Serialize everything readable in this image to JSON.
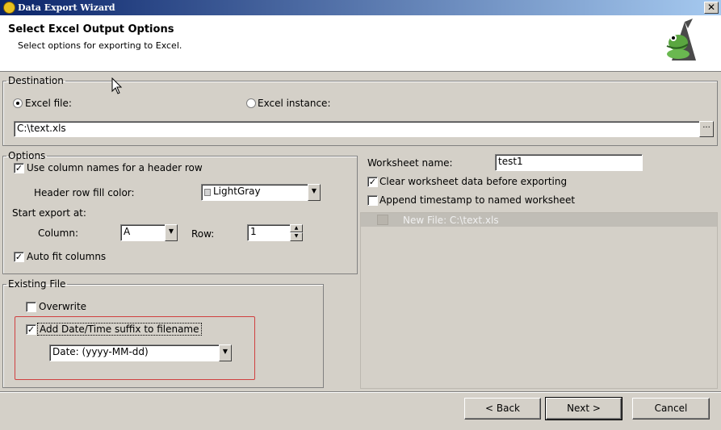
{
  "window": {
    "title": "Data Export Wizard",
    "close_glyph": "✕"
  },
  "header": {
    "title": "Select Excel Output Options",
    "subtitle": "Select options for exporting to Excel."
  },
  "destination": {
    "legend": "Destination",
    "excel_file_label": "Excel file:",
    "excel_instance_label": "Excel instance:",
    "file_path": "C:\\text.xls",
    "browse_label": "···"
  },
  "options": {
    "legend": "Options",
    "use_column_names_label": "Use column names for a header row",
    "header_fill_label": "Header row fill color:",
    "header_fill_value": "LightGray",
    "start_export_label": "Start export at:",
    "column_label": "Column:",
    "column_value": "A",
    "row_label": "Row:",
    "row_value": "1",
    "auto_fit_label": "Auto fit columns"
  },
  "existing_file": {
    "legend": "Existing File",
    "overwrite_label": "Overwrite",
    "date_suffix_label": "Add Date/Time suffix to filename",
    "date_format_value": "Date: (yyyy-MM-dd)"
  },
  "worksheet": {
    "name_label": "Worksheet name:",
    "name_value": "test1",
    "clear_label": "Clear worksheet data before exporting",
    "timestamp_label": "Append timestamp to named worksheet",
    "tree_item_label": "New File: C:\\text.xls"
  },
  "footer": {
    "back_label": "< Back",
    "next_label": "Next >",
    "cancel_label": "Cancel"
  },
  "check_glyph": "✓"
}
